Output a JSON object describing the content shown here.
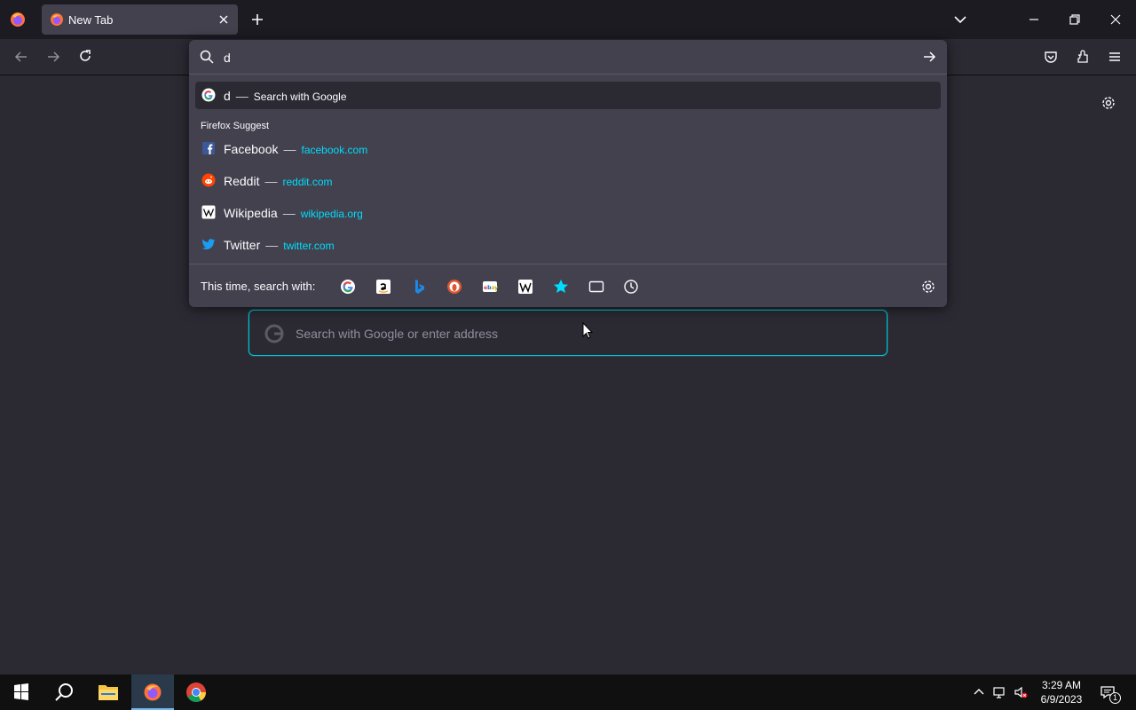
{
  "browser": {
    "tab_title": "New Tab"
  },
  "urlbar": {
    "input_value": "d",
    "heuristic": {
      "query": "d",
      "separator": "—",
      "action": "Search with Google"
    },
    "group_label": "Firefox Suggest",
    "suggestions": [
      {
        "title": "Facebook",
        "separator": "—",
        "url": "facebook.com",
        "icon": "facebook-icon"
      },
      {
        "title": "Reddit",
        "separator": "—",
        "url": "reddit.com",
        "icon": "reddit-icon"
      },
      {
        "title": "Wikipedia",
        "separator": "—",
        "url": "wikipedia.org",
        "icon": "wikipedia-icon"
      },
      {
        "title": "Twitter",
        "separator": "—",
        "url": "twitter.com",
        "icon": "twitter-icon"
      }
    ],
    "oneoff_label": "This time, search with:",
    "oneoff_engines": [
      "google-icon",
      "amazon-icon",
      "bing-icon",
      "duckduckgo-icon",
      "ebay-icon",
      "wikipedia-icon",
      "bookmarks-icon",
      "tabs-icon",
      "history-icon"
    ]
  },
  "newtab": {
    "search_placeholder": "Search with Google or enter address"
  },
  "taskbar": {
    "time": "3:29 AM",
    "date": "6/9/2023",
    "notification_count": "1"
  },
  "colors": {
    "accent": "#00ddff",
    "focus_ring": "#00c8d7",
    "popup_bg": "#42414d",
    "page_bg": "#2b2a33"
  }
}
